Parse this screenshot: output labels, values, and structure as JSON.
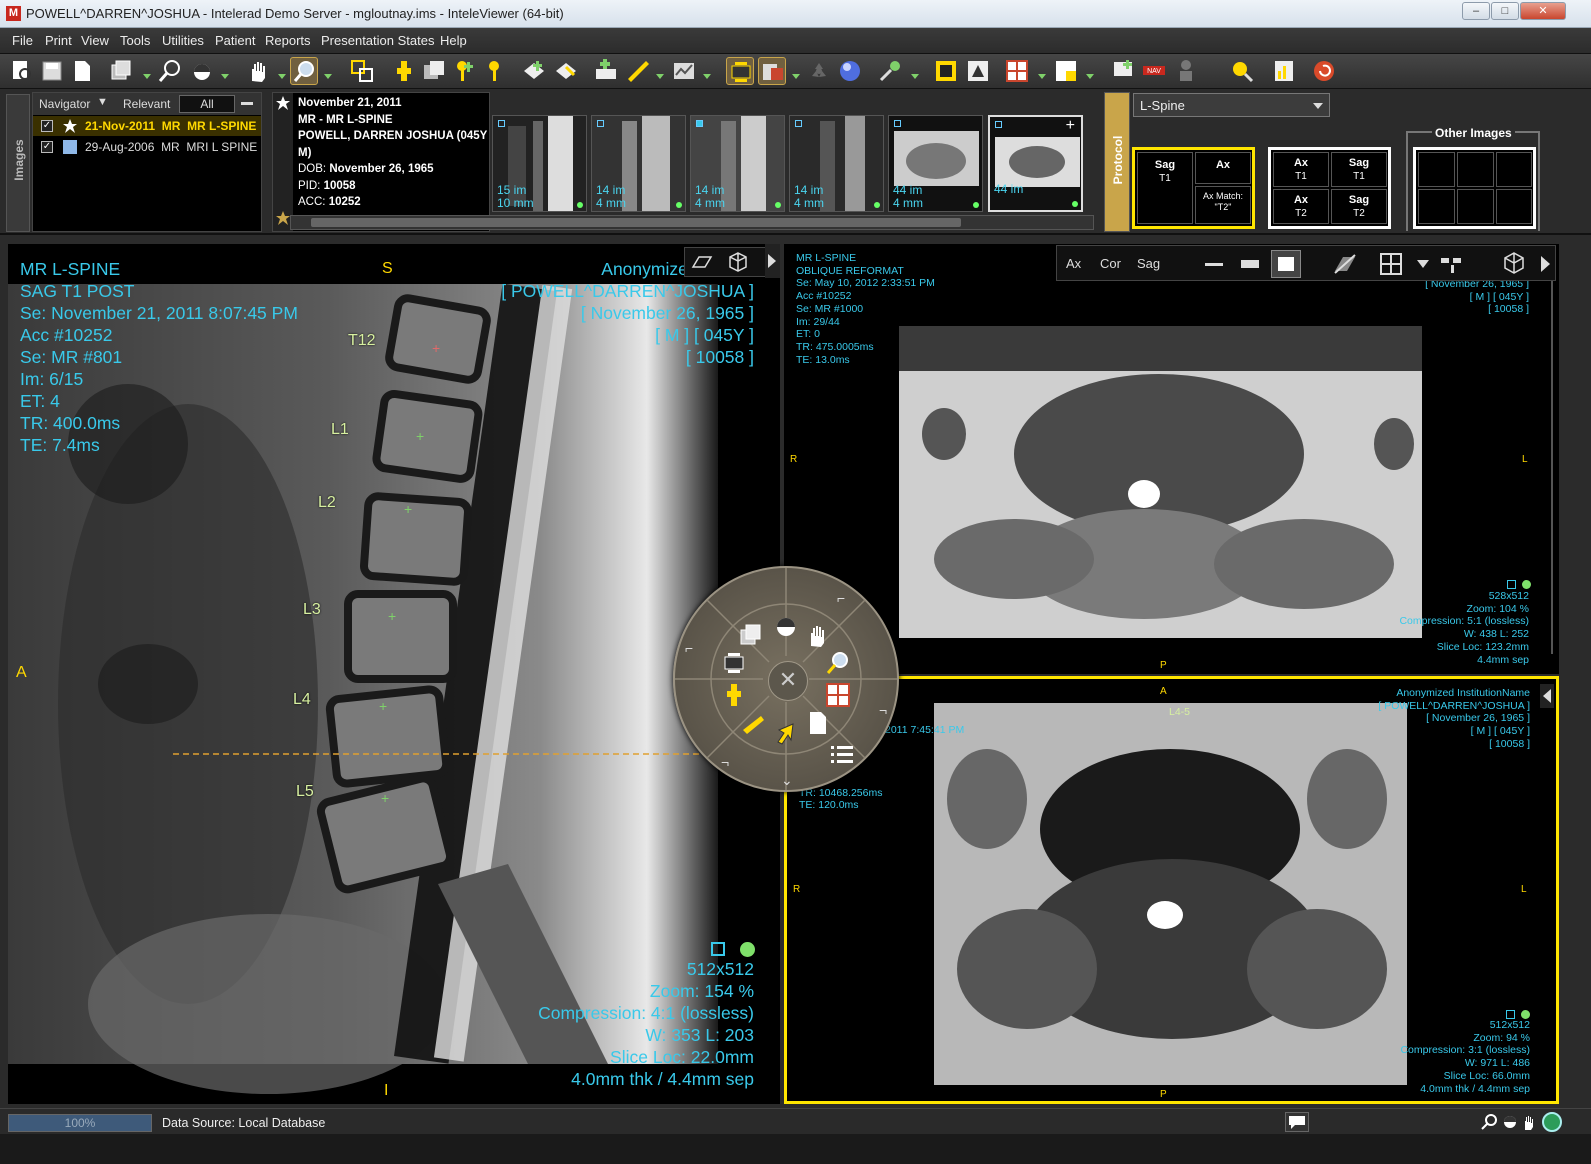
{
  "window": {
    "title": "POWELL^DARREN^JOSHUA - Intelerad Demo Server - mgloutnay.ims - InteleViewer (64-bit)",
    "app_icon": "M"
  },
  "menu": [
    "File",
    "Print",
    "View",
    "Tools",
    "Utilities",
    "Patient",
    "Reports",
    "Presentation States",
    "Help"
  ],
  "navigator": {
    "title": "Navigator",
    "relevant": "Relevant",
    "all": "All",
    "studies": [
      {
        "date": "21-Nov-2011",
        "mod": "MR",
        "desc": "MR L-SPINE",
        "selected": true,
        "icon": "star-icon"
      },
      {
        "date": "29-Aug-2006",
        "mod": "MR",
        "desc": "MRI L SPINE",
        "selected": false,
        "icon": "study-icon"
      }
    ]
  },
  "study": {
    "date": "November 21, 2011",
    "desc": "MR - MR L-SPINE",
    "patient": "POWELL, DARREN JOSHUA (045Y M)",
    "dob_label": "DOB:",
    "dob": "November 26, 1965",
    "pid_label": "PID:",
    "pid": "10058",
    "acc_label": "ACC:",
    "acc": "10252"
  },
  "thumbnails": [
    {
      "count": "15 im",
      "thick": "10 mm"
    },
    {
      "count": "14 im",
      "thick": "4 mm"
    },
    {
      "count": "14 im",
      "thick": "4 mm"
    },
    {
      "count": "14 im",
      "thick": "4 mm"
    },
    {
      "count": "44 im",
      "thick": "4 mm"
    },
    {
      "count": "44 im",
      "thick": ""
    }
  ],
  "tabs": {
    "images": "Images",
    "protocol": "Protocol"
  },
  "protocol": {
    "selected": "L-Spine",
    "other_images": "Other Images",
    "grid1": {
      "sag": "Sag",
      "sag_sub": "T1",
      "ax": "Ax",
      "ax_sub": "Ax Match: \"T2\""
    },
    "grid2": {
      "a": "Ax",
      "a_sub": "T1",
      "b": "Sag",
      "b_sub": "T1",
      "c": "Ax",
      "c_sub": "T2",
      "d": "Sag",
      "d_sub": "T2"
    }
  },
  "viewport_left": {
    "tl": [
      "MR L-SPINE",
      "SAG T1 POST",
      "Se: November 21, 2011 8:07:45 PM",
      "Acc #10252",
      "Se: MR #801",
      "Im: 6/15",
      "ET: 4",
      "TR: 400.0ms",
      "TE: 7.4ms"
    ],
    "tr": [
      "Anonymized Institut",
      "[ POWELL^DARREN^JOSHUA ]",
      "[ November 26, 1965 ]",
      "[ M ] [ 045Y ]",
      "[ 10058 ]"
    ],
    "br": [
      "512x512",
      "Zoom: 154 %",
      "Compression: 4:1 (lossless)",
      "W: 353 L: 203",
      "Slice Loc: 22.0mm",
      "4.0mm thk / 4.4mm sep"
    ],
    "orient": {
      "top": "S",
      "left": "A",
      "bottom": "I"
    },
    "vertebrae": [
      "T12",
      "L1",
      "L2",
      "L3",
      "L4",
      "L5"
    ]
  },
  "viewport_r1": {
    "tl": [
      "MR L-SPINE",
      "OBLIQUE REFORMAT",
      "Se: May 10, 2012 2:33:51 PM",
      "Acc #10252",
      "Se: MR #1000",
      "Im: 29/44",
      "ET: 0",
      "TR: 475.0005ms",
      "TE: 13.0ms"
    ],
    "tr": [
      "[ November 26, 1965 ]",
      "[ M ] [ 045Y ]",
      "[ 10058 ]"
    ],
    "br": [
      "528x512",
      "Zoom: 104 %",
      "Compression: 5:1 (lossless)",
      "W: 438 L: 252",
      "Slice Loc: 123.2mm",
      "4.4mm sep"
    ],
    "orient": {
      "left": "R",
      "right": "L",
      "bottom": "P"
    },
    "toolbar": [
      "Ax",
      "Cor",
      "Sag"
    ]
  },
  "viewport_r2": {
    "tl": [
      "2011 7:45:41 PM",
      "TR: 10468.256ms",
      "TE: 120.0ms"
    ],
    "tr": [
      "Anonymized InstitutionName",
      "[ POWELL^DARREN^JOSHUA ]",
      "[ November 26, 1965 ]",
      "[ M ] [ 045Y ]",
      "[ 10058 ]"
    ],
    "br": [
      "512x512",
      "Zoom: 94 %",
      "Compression: 3:1 (lossless)",
      "W: 971 L: 486",
      "Slice Loc: 66.0mm",
      "4.0mm thk / 4.4mm sep"
    ],
    "orient": {
      "top": "A",
      "left": "R",
      "right": "L",
      "bottom": "P"
    },
    "level": "L4-5"
  },
  "status": {
    "progress": "100%",
    "datasource": "Data Source: Local Database"
  },
  "colors": {
    "overlay": "#39c9ea",
    "highlight": "#ffe600",
    "orient": "#ffd800"
  }
}
